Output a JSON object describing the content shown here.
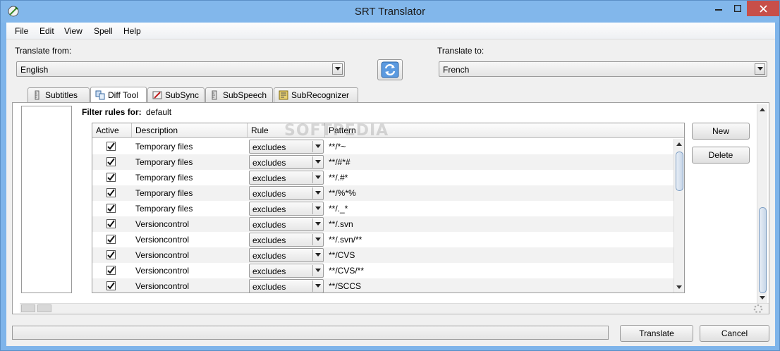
{
  "window": {
    "title": "SRT Translator"
  },
  "menu": [
    "File",
    "Edit",
    "View",
    "Spell",
    "Help"
  ],
  "translate_from": {
    "label": "Translate from:",
    "value": "English"
  },
  "translate_to": {
    "label": "Translate to:",
    "value": "French"
  },
  "tabs": [
    {
      "label": "Subtitles",
      "icon": "ruler-icon"
    },
    {
      "label": "Diff Tool",
      "icon": "diff-icon",
      "active": true
    },
    {
      "label": "SubSync",
      "icon": "sync-icon"
    },
    {
      "label": "SubSpeech",
      "icon": "speech-icon"
    },
    {
      "label": "SubRecognizer",
      "icon": "recognizer-icon"
    }
  ],
  "filter": {
    "label": "Filter rules for:",
    "value": "default"
  },
  "table": {
    "columns": [
      "Active",
      "Description",
      "Rule",
      "Pattern"
    ],
    "rows": [
      {
        "active": true,
        "description": "Temporary files",
        "rule": "excludes",
        "pattern": "**/*~"
      },
      {
        "active": true,
        "description": "Temporary files",
        "rule": "excludes",
        "pattern": "**/#*#"
      },
      {
        "active": true,
        "description": "Temporary files",
        "rule": "excludes",
        "pattern": "**/.#*"
      },
      {
        "active": true,
        "description": "Temporary files",
        "rule": "excludes",
        "pattern": "**/%*%"
      },
      {
        "active": true,
        "description": "Temporary files",
        "rule": "excludes",
        "pattern": "**/._*"
      },
      {
        "active": true,
        "description": "Versioncontrol",
        "rule": "excludes",
        "pattern": "**/.svn"
      },
      {
        "active": true,
        "description": "Versioncontrol",
        "rule": "excludes",
        "pattern": "**/.svn/**"
      },
      {
        "active": true,
        "description": "Versioncontrol",
        "rule": "excludes",
        "pattern": "**/CVS"
      },
      {
        "active": true,
        "description": "Versioncontrol",
        "rule": "excludes",
        "pattern": "**/CVS/**"
      },
      {
        "active": true,
        "description": "Versioncontrol",
        "rule": "excludes",
        "pattern": "**/SCCS"
      }
    ]
  },
  "buttons": {
    "new": "New",
    "delete": "Delete",
    "translate": "Translate",
    "cancel": "Cancel"
  },
  "watermark": "SOFTPEDIA"
}
